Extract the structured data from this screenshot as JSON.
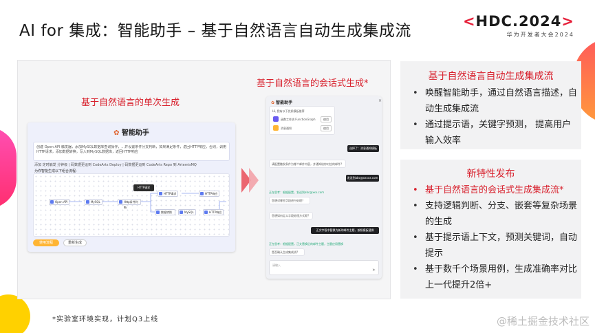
{
  "slide": {
    "title": "AI for 集成：智能助手 – 基于自然语言自动生成集成流",
    "brand": {
      "logo": "HDC.2024",
      "chevron_left": "<",
      "chevron_right": ">",
      "subtitle": "华为开发者大会2024"
    }
  },
  "demo": {
    "single_label": "基于自然语言的单次生成",
    "conversational_label": "基于自然语言的会话式生成*",
    "shot1": {
      "header": "智能助手",
      "request_text": "创建 Open API 触发器，添加MySQL数据库查询操作，…并设置条件分支判断，如果满足条件，返回HTTP响应，否则，调用HTTP请求，添加数据转换，写入到MySQL数据库，返回HTTP响应",
      "links_line": "添加 定时触发 分钟级 | 码数据更运到 CodeArts Deploy | 码数据更运到 CodeArts Repo 到 ArtemisMQ",
      "flow_caption": "为你智能生成以下组合流程:",
      "tooltip": "HTTP请求",
      "node_labels": [
        "Open API",
        "MySQL",
        "Http条件判断",
        "HTTP请求",
        "HTTP响应",
        "数据转换",
        "MySQL",
        "HTTP响应"
      ],
      "btn_primary": "使用流程",
      "btn_secondary": "重新生成"
    },
    "shot2": {
      "header": "智能助手",
      "hint": "Hi, 我有以下优质模板推荐",
      "template1": "函数工作流 FunctionGraph",
      "template2": "消息通知",
      "use_label": "使用",
      "bubble1": "选择了：消息通知模板",
      "reply1": "请配置触发条件为哪个邮件内容，并通知给你对应的邮件?",
      "bubble2": "发送到abc@xxxxx.com",
      "thinking1": "正在思考：根据配置，发送到abc@xxx.com",
      "reply2": "您想对哪些字段进行处理？",
      "reply3": "您想如何定义字段处理方式呢?",
      "bubble3": "正文字段中替换为新的邮件主题，按照模板替换",
      "thinking2": "正在思考：根据配置，正文替换后的邮件主题，主题应用替换",
      "reply4": "是否确认生成集成流?",
      "input_placeholder": "请输入"
    }
  },
  "panel1": {
    "title": "基于自然语言自动生成集成流",
    "bullets": [
      "唤醒智能助手，通过自然语言描述，自动生成集成流",
      "通过提示语，关键字预测， 提高用户输入效率"
    ]
  },
  "panel2": {
    "title": "新特性发布",
    "bullets": [
      "基于自然语言的会话式生成集成流*",
      "支持逻辑判断、分支、嵌套等复杂场景的生成",
      "基于提示语上下文，预测关键词，自动提示",
      "基于数千个场景用例，生成准确率对比上一代提升2倍+"
    ]
  },
  "footnote": "*实验室环境实现，计划Q3上线",
  "watermark": "@稀土掘金技术社区",
  "colors": {
    "accent_red": "#d8202c",
    "panel_bg": "#f2f2f3",
    "orange_button": "#ffb534"
  }
}
